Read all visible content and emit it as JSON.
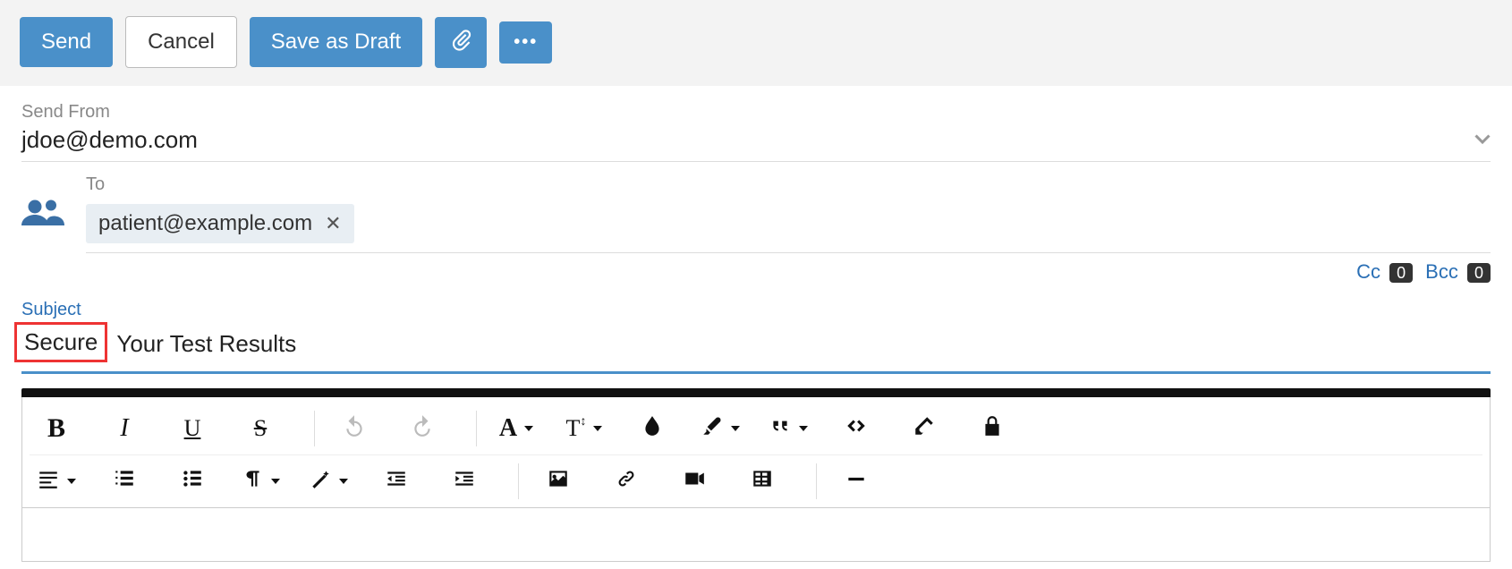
{
  "toolbar": {
    "send": "Send",
    "cancel": "Cancel",
    "save_draft": "Save as Draft"
  },
  "from": {
    "label": "Send From",
    "value": "jdoe@demo.com"
  },
  "to": {
    "label": "To",
    "chip": "patient@example.com"
  },
  "cc": {
    "label": "Cc",
    "count": "0"
  },
  "bcc": {
    "label": "Bcc",
    "count": "0"
  },
  "subject": {
    "label": "Subject",
    "secure_tag": "Secure",
    "value": "Your Test Results"
  },
  "editor": {
    "bold": "B",
    "italic": "I",
    "underline": "U",
    "strike": "S",
    "font_label": "A",
    "size_label": "T"
  }
}
